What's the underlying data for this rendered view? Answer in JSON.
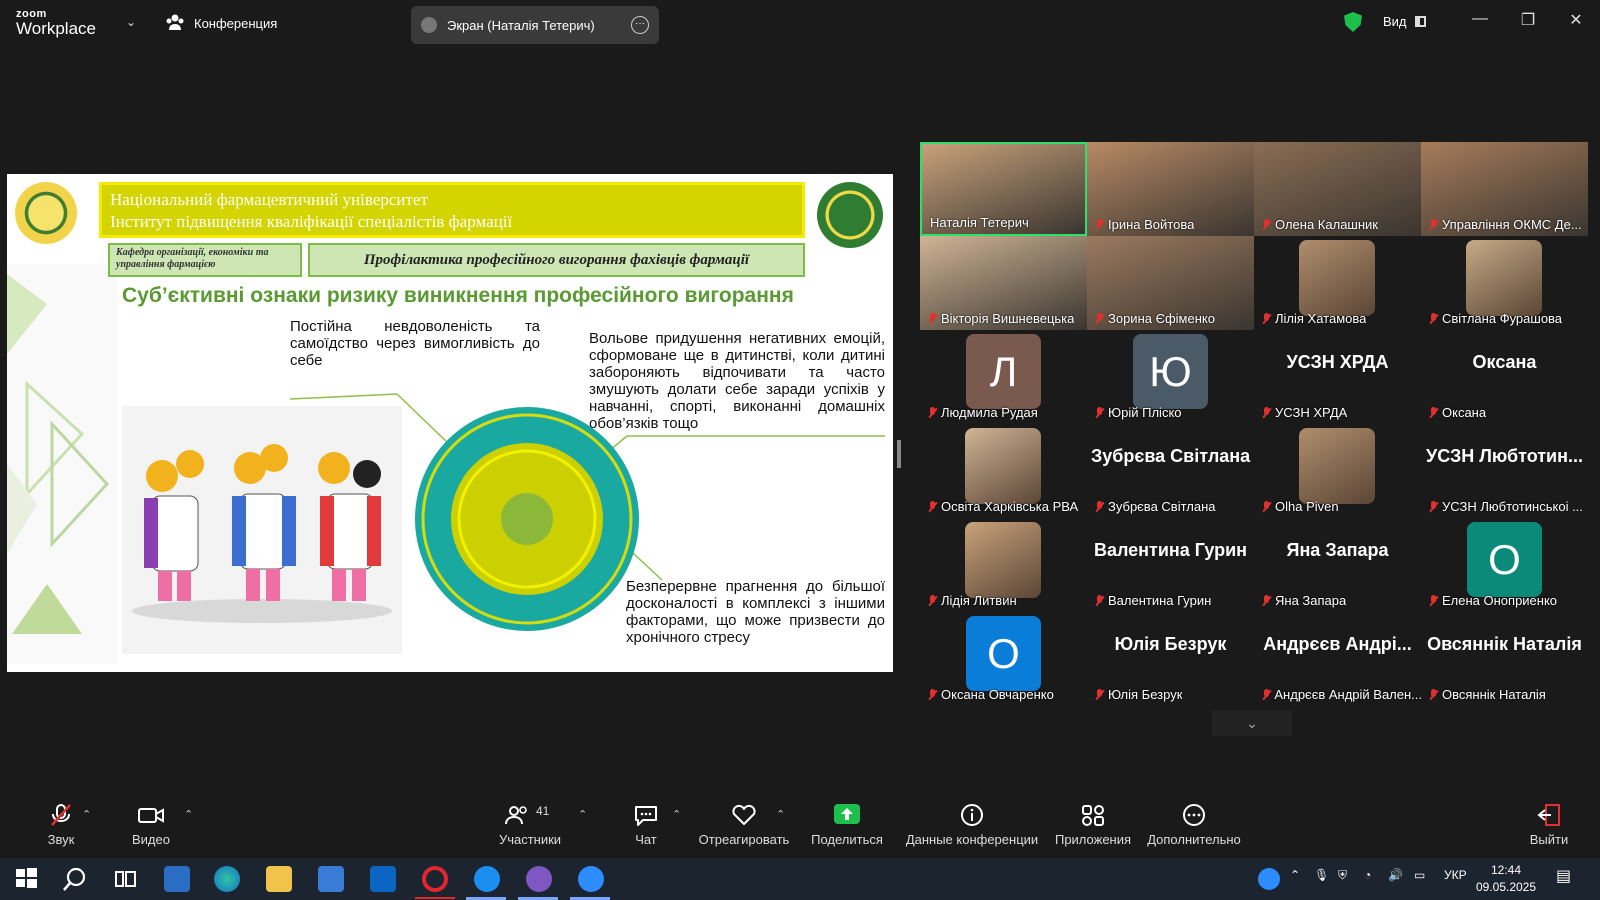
{
  "topbar": {
    "brand_small": "zoom",
    "brand_big": "Workplace",
    "conference_label": "Конференция",
    "screen_share_label": "Экран (Наталія Тетерич)",
    "view_label": "Вид"
  },
  "slide": {
    "header_line1": "Національний фармацевтичний університет",
    "header_line2": "Інститут підвищення кваліфікації спеціалістів фармації",
    "department": "Кафедра організації, економіки та управління фармацією",
    "topic": "Профілактика професійного вигорання фахівців фармації",
    "title": "Суб’єктивні ознаки ризику виникнення професійного вигорання",
    "point1": "Постійна невдоволеність та самоїдство через вимогливість до себе",
    "point2": "Вольове придушення негативних емоцій, сформоване ще в дитинстві, коли дитині забороняють відпочивати та часто змушують долати себе заради успіхів у навчанні, спорті, виконанні домашніх обов’язків тощо",
    "point3": "Безперервне прагнення до більшої досконалості в комплексі з іншими факторами, що може призвести до хронічного стресу"
  },
  "participants": [
    {
      "name": "Наталія Тетерич",
      "kind": "video",
      "muted": false,
      "active": true
    },
    {
      "name": "Ірина Войтова",
      "kind": "video",
      "muted": true
    },
    {
      "name": "Олена Калашник",
      "kind": "video",
      "muted": true
    },
    {
      "name": "Управління ОКМС Де...",
      "kind": "video",
      "muted": true
    },
    {
      "name": "Вікторія Вишневецька",
      "kind": "video",
      "muted": true
    },
    {
      "name": "Зорина Єфіменко",
      "kind": "video",
      "muted": true
    },
    {
      "name": "Лілія Хатамова",
      "kind": "photo",
      "muted": true
    },
    {
      "name": "Світлана Фурашова",
      "kind": "photo",
      "muted": true
    },
    {
      "name": "Людмила Рудая",
      "kind": "letter",
      "letter": "Л",
      "color": "#7a5a4e",
      "muted": true
    },
    {
      "name": "Юрій Пліско",
      "kind": "letter",
      "letter": "Ю",
      "color": "#4a5a66",
      "muted": true
    },
    {
      "name": "УСЗН ХРДА",
      "kind": "text",
      "big": "УСЗН ХРДА",
      "muted": true
    },
    {
      "name": "Оксана",
      "kind": "text",
      "big": "Оксана",
      "muted": true
    },
    {
      "name": "Освіта Харківська РВА",
      "kind": "photo",
      "muted": true
    },
    {
      "name": "Зубрєва Світлана",
      "kind": "text",
      "big": "Зубрєва Світлана",
      "muted": true
    },
    {
      "name": "Olha Piven",
      "kind": "photo",
      "muted": true
    },
    {
      "name": "УСЗН Любтотинськоі ...",
      "kind": "text",
      "big": "УСЗН Любтотин...",
      "muted": true
    },
    {
      "name": "Лідія Литвин",
      "kind": "photo",
      "muted": true
    },
    {
      "name": "Валентина Гурин",
      "kind": "text",
      "big": "Валентина Гурин",
      "muted": true
    },
    {
      "name": "Яна Запара",
      "kind": "text",
      "big": "Яна Запара",
      "muted": true
    },
    {
      "name": "Елена Оноприенко",
      "kind": "letter",
      "letter": "О",
      "color": "#0b8a7a",
      "muted": true
    },
    {
      "name": "Оксана Овчаренко",
      "kind": "letter",
      "letter": "О",
      "color": "#0a7dd8",
      "muted": true
    },
    {
      "name": "Юлія Безрук",
      "kind": "text",
      "big": "Юлія Безрук",
      "muted": true
    },
    {
      "name": "Андрєєв Андрій Вален...",
      "kind": "text",
      "big": "Андрєєв Андрі...",
      "muted": true
    },
    {
      "name": "Овсяннік Наталія",
      "kind": "text",
      "big": "Овсяннік Наталія",
      "muted": true
    }
  ],
  "toolbar": {
    "audio": "Звук",
    "video": "Видео",
    "participants": "Участники",
    "participants_count": "41",
    "chat": "Чат",
    "react": "Отреагировать",
    "share": "Поделиться",
    "meeting_info": "Данные конференции",
    "apps": "Приложения",
    "more": "Дополнительно",
    "leave": "Выйти"
  },
  "taskbar": {
    "language": "УКР",
    "time": "12:44",
    "date": "09.05.2025"
  },
  "colors": {
    "accent_green": "#2ee06b",
    "mute_red": "#e0302f",
    "share_green": "#1dbf4d"
  }
}
